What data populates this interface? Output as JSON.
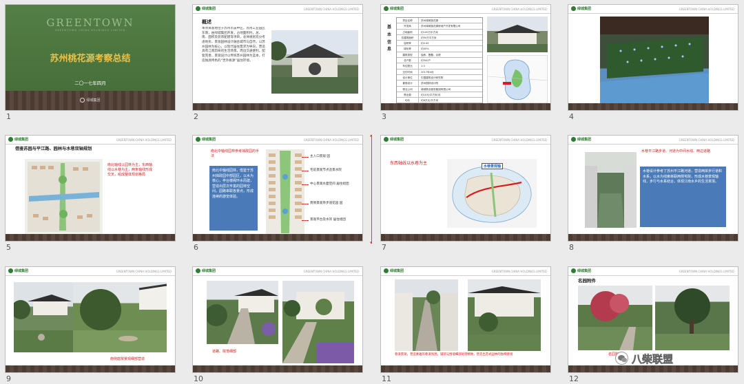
{
  "slides": [
    {
      "num": "1",
      "brand": "GREENTOWN",
      "brand_sub": "GREENTOWN CHINA HOLDINGS LIMITED",
      "title": "苏州桃花源考察总结",
      "date": "二〇一七年四月",
      "footer_logo": "绿城集团"
    },
    {
      "num": "2",
      "heading": "概述",
      "body": "本项目基地位于苏州市吴中区，苏州工业园区东南，由绿城集团开发，占地面积约，总、南、面积及装饰配建等项目，总体规划充分考虑地形，景观园林设计融合城市与自然，以苏州园林为核心，以现代居住需求为导向，营造具有江南韵味的生活场景。周边交通便利，配套完善，景观设计以传统苏州园林为蓝本，打造独具特色的“世外桃源”居住环境。"
    },
    {
      "num": "3",
      "side_title": "基本信息",
      "table_rows": [
        [
          "项目名称",
          "苏州绿城桃花源"
        ],
        [
          "开发商",
          "苏州绿城桃花源房地产开发有限公司"
        ],
        [
          "占地面积",
          "约100万平方米"
        ],
        [
          "总建筑面积",
          "约50万平方米"
        ],
        [
          "容积率",
          "约0.45"
        ],
        [
          "绿化率",
          "约45%"
        ],
        [
          "建筑类型",
          "独栋、叠墅、合院"
        ],
        [
          "总户数",
          "约500户"
        ],
        [
          "车位配比",
          "1:3"
        ],
        [
          "交付时间",
          "2017年4月"
        ],
        [
          "设计单位",
          "中国建筑设计研究院"
        ],
        [
          "景观设计",
          "苏州园林设计院"
        ],
        [
          "物业公司",
          "绿城物业服务集团有限公司"
        ],
        [
          "物业费",
          "约10元/平方米/月"
        ],
        [
          "均价",
          "约8万元/平方米"
        ]
      ]
    },
    {
      "num": "4"
    },
    {
      "num": "5",
      "heading": "借鉴苏园与平江路、园林与水巷双轴规划",
      "red_note": "南北轴线以园林为主，东西轴线以水巷为主，两条轴线形成交叉，组成整体规划格局"
    },
    {
      "num": "6",
      "red_title": "南北中轴线园林参考拙政园的手法",
      "blue_text": "南北中轴线园林，借鉴于苏州拙政园中部园区，以水为核心，亭台楼阁环水而建，营造出层次丰富的园林空间，园路串联各景点，形成连续的游览体验。",
      "callouts": [
        "主入口景观 园",
        "宅前景观节点造景水院",
        "中心景观水面空间 居住组团",
        "南侧景观带步道花园 园",
        "景观平台及水岸 居住组团"
      ]
    },
    {
      "num": "7",
      "red_title": "东西轴线以水巷为主",
      "map_label": "水巷景观轴"
    },
    {
      "num": "8",
      "red_title": "水巷平江路步道、河道为中间水线、两边道路",
      "blue_text": "水巷设计参考了苏州平江路河道，营造两岸步行道和水系，以水为线索串联两侧宅院，形成水巷景观轴线，步行与水系结合，体现江南水乡的生活意境。"
    },
    {
      "num": "9",
      "caption": "南侧庭院景观细部营造"
    },
    {
      "num": "10",
      "caption": "道路、院落细部"
    },
    {
      "num": "11",
      "caption": "巷道景观，营造素雅的巷道氛围，铺装与围墙细部处理精致，营造出苏式园林的独特意境"
    },
    {
      "num": "12",
      "heading": "名园附件",
      "caption": "名园附件"
    }
  ],
  "watermark": "八柴联盟",
  "watermark_icon": "wechat-icon",
  "colors": {
    "green": "#4b7a3e",
    "gold": "#e8c24c",
    "red": "#d81b1b",
    "blue": "#4a7bb8",
    "stone": "#4c3b33"
  }
}
